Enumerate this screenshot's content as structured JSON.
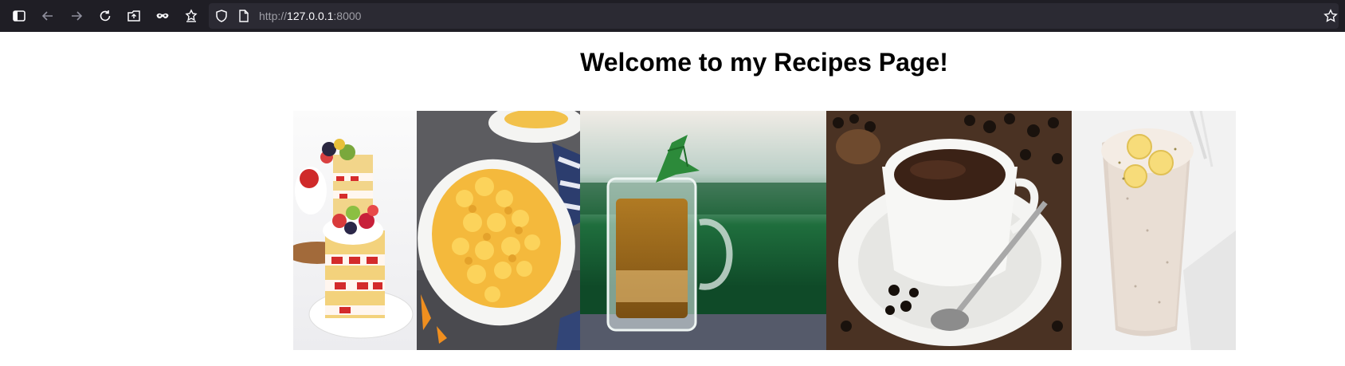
{
  "browser": {
    "url_scheme": "http://",
    "url_host": "127.0.0.1",
    "url_port": ":8000",
    "icons": [
      "sidebar-icon",
      "back-icon",
      "forward-icon",
      "reload-icon",
      "screenshot-icon",
      "private-mask-icon",
      "extensions-icon",
      "shield-icon",
      "page-icon",
      "star-icon"
    ]
  },
  "page": {
    "title": "Welcome to my Recipes Page!"
  },
  "gallery": {
    "images": [
      "cake",
      "mac-and-cheese",
      "tea",
      "coffee",
      "banana-smoothie"
    ]
  }
}
